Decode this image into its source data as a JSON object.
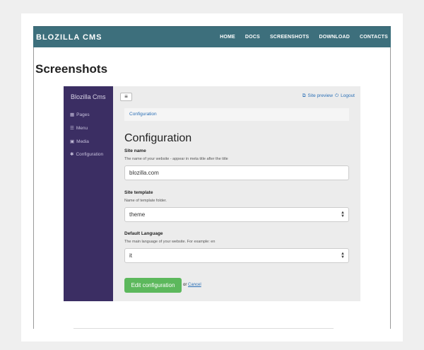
{
  "site": {
    "brand": "BLOZILLA CMS",
    "nav": [
      "HOME",
      "DOCS",
      "SCREENSHOTS",
      "DOWNLOAD",
      "CONTACTS"
    ],
    "page_title": "Screenshots"
  },
  "screenshot": {
    "sidebar": {
      "brand": "Blozilla Cms",
      "items": [
        {
          "icon": "grid-icon",
          "label": "Pages"
        },
        {
          "icon": "menu-icon",
          "label": "Menu"
        },
        {
          "icon": "image-icon",
          "label": "Media"
        },
        {
          "icon": "gear-icon",
          "label": "Configuration"
        }
      ]
    },
    "topbar": {
      "site_preview": "Site preview",
      "logout": "Logout"
    },
    "breadcrumb": "Configuration",
    "heading": "Configuration",
    "fields": {
      "site_name": {
        "label": "Site name",
        "help": "The name of your website - appear in meta title after the title",
        "value": "blozilla.com"
      },
      "site_template": {
        "label": "Site template",
        "help": "Name of template folder.",
        "value": "theme"
      },
      "default_language": {
        "label": "Default Language",
        "help": "The main language of your website. For example: en",
        "value": "it"
      }
    },
    "actions": {
      "submit": "Edit configuration",
      "or": "or",
      "cancel": "Cancel"
    }
  },
  "colors": {
    "nav_bg": "#3d6f7c",
    "sidebar_bg": "#3b2e63",
    "button": "#5cb85c",
    "link": "#2a6fb6"
  }
}
